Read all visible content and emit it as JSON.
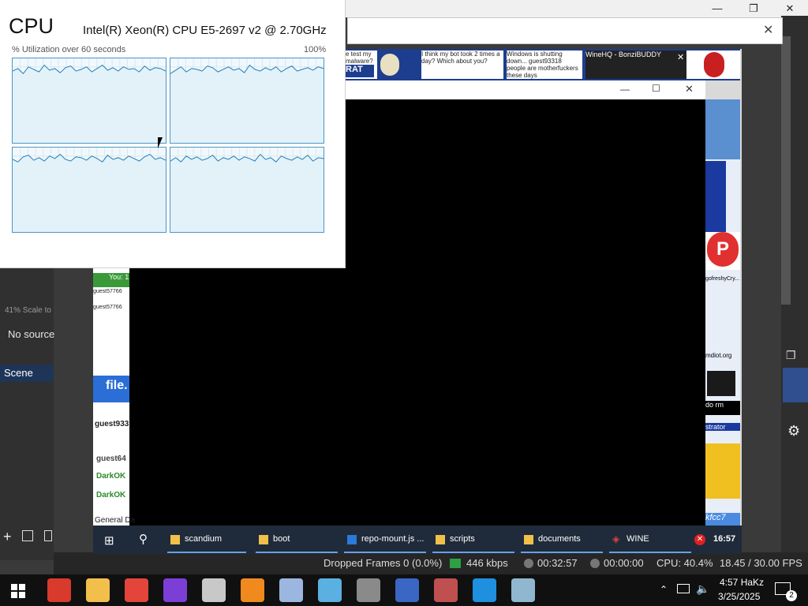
{
  "cpu": {
    "title": "CPU",
    "processor": "Intel(R) Xeon(R) CPU E5-2697 v2 @ 2.70GHz",
    "graph_label": "% Utilization over 60 seconds",
    "graph_max": "100%",
    "cores": [
      [
        85,
        88,
        82,
        90,
        87,
        84,
        92,
        86,
        88,
        83,
        89,
        91,
        85,
        87,
        90,
        84,
        88,
        92,
        86,
        89,
        85,
        90,
        87,
        88,
        84,
        91,
        86,
        89,
        88,
        85
      ],
      [
        82,
        86,
        90,
        84,
        88,
        87,
        85,
        91,
        89,
        84,
        87,
        90,
        86,
        88,
        83,
        92,
        87,
        85,
        89,
        86,
        90,
        84,
        88,
        91,
        85,
        87,
        89,
        86,
        90,
        88
      ],
      [
        86,
        83,
        89,
        91,
        85,
        88,
        84,
        90,
        87,
        92,
        86,
        84,
        89,
        88,
        85,
        90,
        87,
        83,
        91,
        86,
        88,
        85,
        90,
        87,
        84,
        89,
        92,
        86,
        88,
        85
      ],
      [
        84,
        88,
        83,
        90,
        86,
        89,
        85,
        87,
        91,
        84,
        88,
        86,
        90,
        85,
        89,
        87,
        84,
        92,
        86,
        88,
        83,
        90,
        87,
        85,
        89,
        86,
        91,
        84,
        88,
        87
      ]
    ]
  },
  "obs": {
    "scale_label": "41%  Scale to",
    "no_source": "No source",
    "scene_label": "Scene",
    "status": {
      "dropped_frames": "Dropped Frames 0 (0.0%)",
      "bitrate": "446 kbps",
      "time_live": "00:32:57",
      "time_rec": "00:00:00",
      "cpu": "CPU: 40.4%",
      "fps": "18.45 / 30.00 FPS"
    }
  },
  "projector": {
    "thumbs": [
      {
        "text": "e test my malware?"
      },
      {
        "text": "RAT"
      },
      {
        "text": "I think my bot took 2 times a day? Which about you?"
      },
      {
        "text": "Windows is shutting down... guest93318 people are motherfuckers these days"
      },
      {
        "text": "WineHQ - BonziBUDDY"
      }
    ],
    "left_items": [
      "You: 1",
      "guest57766",
      "guest57766",
      "file.",
      "guest933",
      "guest64",
      "DarkOK",
      "DarkOK",
      "General Da"
    ],
    "right_items": [
      "gofreshyCry...",
      "mdiot.org",
      "do rm",
      "strator",
      "kfcc7"
    ],
    "taskbar": {
      "items": [
        {
          "label": "scandium"
        },
        {
          "label": "boot"
        },
        {
          "label": "repo-mount.js ..."
        },
        {
          "label": "scripts"
        },
        {
          "label": "documents"
        },
        {
          "label": "WINE"
        }
      ],
      "clock": "16:57"
    }
  },
  "taskbar": {
    "time": "4:57 HaKz",
    "date": "3/25/2025",
    "notification_count": "2",
    "apps": [
      {
        "name": "app-red-icon",
        "color": "#d83a2c"
      },
      {
        "name": "file-explorer-icon",
        "color": "#f2c04a"
      },
      {
        "name": "chrome-icon",
        "color": "#e3453a"
      },
      {
        "name": "app-swirl-icon",
        "color": "#7b3fd6"
      },
      {
        "name": "app-tray-icon",
        "color": "#c8c8c8"
      },
      {
        "name": "search-app-icon",
        "color": "#f08a1e"
      },
      {
        "name": "paint-icon",
        "color": "#9bb7e0"
      },
      {
        "name": "app-blue-icon",
        "color": "#5ab0e0"
      },
      {
        "name": "app-globe-icon",
        "color": "#8a8a8a"
      },
      {
        "name": "app-bonzi-icon",
        "color": "#3a66c4"
      },
      {
        "name": "app-people-icon",
        "color": "#c05050"
      },
      {
        "name": "ie-icon",
        "color": "#1f8fe0"
      },
      {
        "name": "task-manager-icon",
        "color": "#8fb8d0"
      }
    ]
  }
}
